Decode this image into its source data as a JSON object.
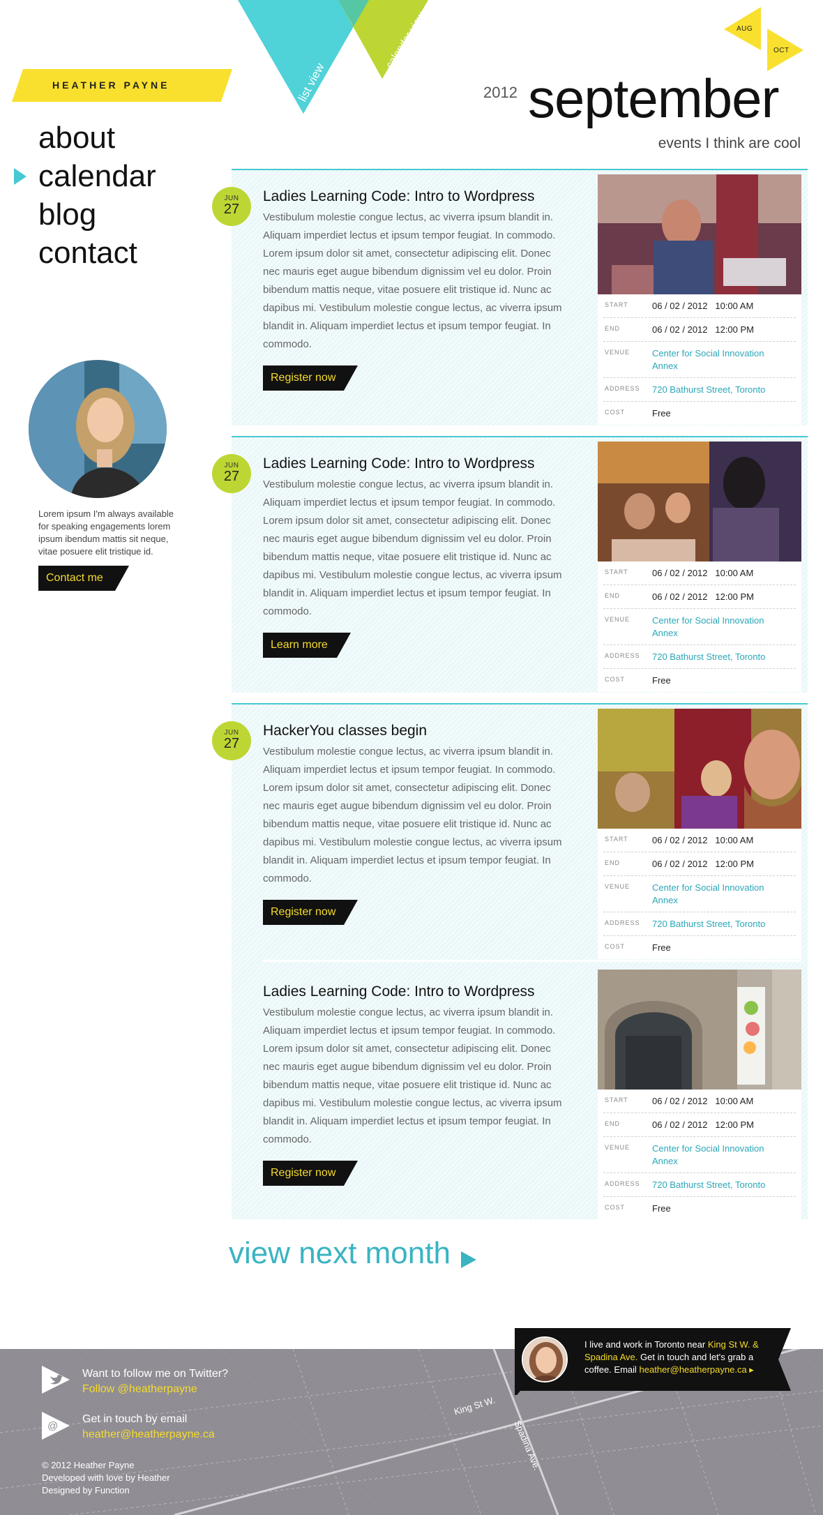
{
  "brand": {
    "name": "HEATHER PAYNE",
    "accent": "#45c9d4",
    "yellow": "#f9e02f",
    "green": "#bdd633"
  },
  "views": {
    "list": "list view",
    "calendar": "calendar view"
  },
  "month_nav": {
    "prev": "AUG",
    "next": "OCT"
  },
  "nav": {
    "items": [
      "about",
      "calendar",
      "blog",
      "contact"
    ],
    "active": "calendar"
  },
  "header": {
    "year": "2012",
    "month": "september",
    "tagline": "events I think are cool"
  },
  "sidebar": {
    "bio": "Lorem ipsum I'm always available for speaking engagements lorem ipsum ibendum mattis sit neque, vitae posuere elit tristique id.",
    "contact_label": "Contact me"
  },
  "labels": {
    "start": "START",
    "end": "END",
    "venue": "VENUE",
    "address": "ADDRESS",
    "cost": "COST"
  },
  "events": [
    {
      "month": "JUN",
      "day": "27",
      "title": "Ladies Learning Code: Intro to Wordpress",
      "description": "Vestibulum molestie congue lectus, ac viverra ipsum blandit in. Aliquam imperdiet lectus et ipsum tempor feugiat. In commodo. Lorem ipsum dolor sit amet, consectetur adipiscing elit. Donec nec mauris eget augue bibendum dignissim vel eu dolor. Proin bibendum mattis neque, vitae posuere elit tristique id. Nunc ac dapibus mi. Vestibulum molestie congue lectus, ac viverra ipsum blandit in. Aliquam imperdiet lectus et ipsum tempor feugiat. In commodo.",
      "button": "Register now",
      "start_date": "06 / 02 / 2012",
      "start_time": "10:00 AM",
      "end_date": "06 / 02 / 2012",
      "end_time": "12:00 PM",
      "venue": "Center for Social Innovation Annex",
      "address": "720 Bathurst Street, Toronto",
      "cost": "Free"
    },
    {
      "month": "JUN",
      "day": "27",
      "title": "Ladies Learning Code: Intro to Wordpress",
      "description": "Vestibulum molestie congue lectus, ac viverra ipsum blandit in. Aliquam imperdiet lectus et ipsum tempor feugiat. In commodo. Lorem ipsum dolor sit amet, consectetur adipiscing elit. Donec nec mauris eget augue bibendum dignissim vel eu dolor. Proin bibendum mattis neque, vitae posuere elit tristique id. Nunc ac dapibus mi. Vestibulum molestie congue lectus, ac viverra ipsum blandit in. Aliquam imperdiet lectus et ipsum tempor feugiat. In commodo.",
      "button": "Learn more",
      "start_date": "06 / 02 / 2012",
      "start_time": "10:00 AM",
      "end_date": "06 / 02 / 2012",
      "end_time": "12:00 PM",
      "venue": "Center for Social Innovation Annex",
      "address": "720 Bathurst Street, Toronto",
      "cost": "Free"
    },
    {
      "month": "JUN",
      "day": "27",
      "title": "HackerYou classes begin",
      "description": "Vestibulum molestie congue lectus, ac viverra ipsum blandit in. Aliquam imperdiet lectus et ipsum tempor feugiat. In commodo. Lorem ipsum dolor sit amet, consectetur adipiscing elit. Donec nec mauris eget augue bibendum dignissim vel eu dolor. Proin bibendum mattis neque, vitae posuere elit tristique id. Nunc ac dapibus mi. Vestibulum molestie congue lectus, ac viverra ipsum blandit in. Aliquam imperdiet lectus et ipsum tempor feugiat. In commodo.",
      "button": "Register now",
      "start_date": "06 / 02 / 2012",
      "start_time": "10:00 AM",
      "end_date": "06 / 02 / 2012",
      "end_time": "12:00 PM",
      "venue": "Center for Social Innovation Annex",
      "address": "720 Bathurst Street, Toronto",
      "cost": "Free"
    },
    {
      "title": "Ladies Learning Code: Intro to Wordpress",
      "description": "Vestibulum molestie congue lectus, ac viverra ipsum blandit in. Aliquam imperdiet lectus et ipsum tempor feugiat. In commodo. Lorem ipsum dolor sit amet, consectetur adipiscing elit. Donec nec mauris eget augue bibendum dignissim vel eu dolor. Proin bibendum mattis neque, vitae posuere elit tristique id. Nunc ac dapibus mi. Vestibulum molestie congue lectus, ac viverra ipsum blandit in. Aliquam imperdiet lectus et ipsum tempor feugiat. In commodo.",
      "button": "Register now",
      "start_date": "06 / 02 / 2012",
      "start_time": "10:00 AM",
      "end_date": "06 / 02 / 2012",
      "end_time": "12:00 PM",
      "venue": "Center for Social Innovation Annex",
      "address": "720 Bathurst Street, Toronto",
      "cost": "Free"
    }
  ],
  "view_next": "view next month",
  "footer": {
    "twitter_prompt": "Want to follow me on Twitter?",
    "twitter_link": "Follow @heatherpayne",
    "email_prompt": "Get in touch by email",
    "email_link": "heather@heatherpayne.ca",
    "copyright": "© 2012 Heather Payne",
    "developed": "Developed with love by Heather",
    "designed": "Designed by Function",
    "street_1": "King St W.",
    "street_2": "Spadina Ave.",
    "bubble_pre": "I live and work in Toronto near ",
    "bubble_hl": "King St W. & Spadina Ave.",
    "bubble_mid": " Get in touch and let's grab a coffee. Email ",
    "bubble_email": "heather@heatherpayne.ca ▸"
  }
}
